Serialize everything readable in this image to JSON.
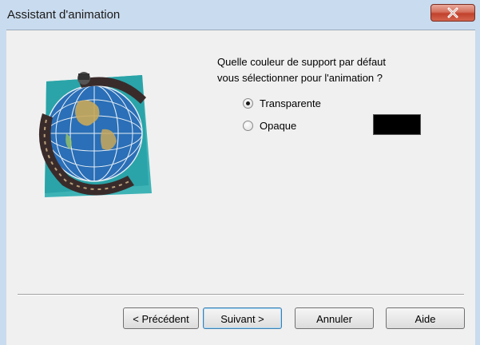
{
  "window": {
    "title": "Assistant d'animation"
  },
  "content": {
    "question_line1": "Quelle couleur de support par défaut",
    "question_line2": "vous sélectionner pour l'animation ?",
    "options": [
      {
        "label": "Transparente",
        "checked": true
      },
      {
        "label": "Opaque",
        "checked": false
      }
    ],
    "opaque_color": "#000000"
  },
  "buttons": {
    "back": "< Précédent",
    "next": "Suivant >",
    "cancel": "Annuler",
    "help": "Aide"
  },
  "icons": {
    "close": "close-icon",
    "illustration": "globe-filmstrip-illustration"
  }
}
